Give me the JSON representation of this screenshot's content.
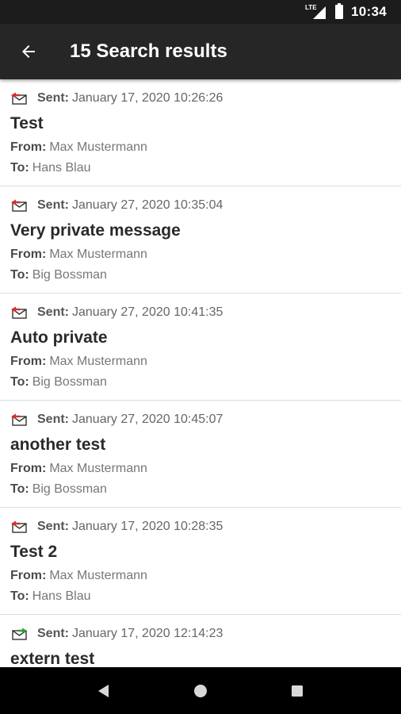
{
  "status_bar": {
    "network": "LTE",
    "time": "10:34"
  },
  "app_bar": {
    "title": "15 Search results",
    "back_icon": "arrow-left-icon"
  },
  "labels": {
    "sent": "Sent:",
    "from": "From:",
    "to": "To:"
  },
  "colors": {
    "outgoing_arrow": "#d32f2f",
    "incoming_arrow": "#2e9e3b",
    "app_bar": "#262626"
  },
  "results": [
    {
      "direction": "outgoing",
      "sent": "January 17, 2020 10:26:26",
      "subject": "Test",
      "from": "Max Mustermann",
      "to": "Hans Blau"
    },
    {
      "direction": "outgoing",
      "sent": "January 27, 2020 10:35:04",
      "subject": "Very private message",
      "from": "Max Mustermann",
      "to": "Big Bossman"
    },
    {
      "direction": "outgoing",
      "sent": "January 27, 2020 10:41:35",
      "subject": "Auto private",
      "from": "Max Mustermann",
      "to": "Big Bossman"
    },
    {
      "direction": "outgoing",
      "sent": "January 27, 2020 10:45:07",
      "subject": "another test",
      "from": "Max Mustermann",
      "to": "Big Bossman"
    },
    {
      "direction": "outgoing",
      "sent": "January 17, 2020 10:28:35",
      "subject": "Test 2",
      "from": "Max Mustermann",
      "to": "Hans Blau"
    },
    {
      "direction": "incoming",
      "sent": "January 17, 2020 12:14:23",
      "subject": "extern test",
      "from": "",
      "to": ""
    }
  ],
  "nav_bar": {
    "back": "nav-back-icon",
    "home": "nav-home-icon",
    "recents": "nav-recents-icon"
  }
}
